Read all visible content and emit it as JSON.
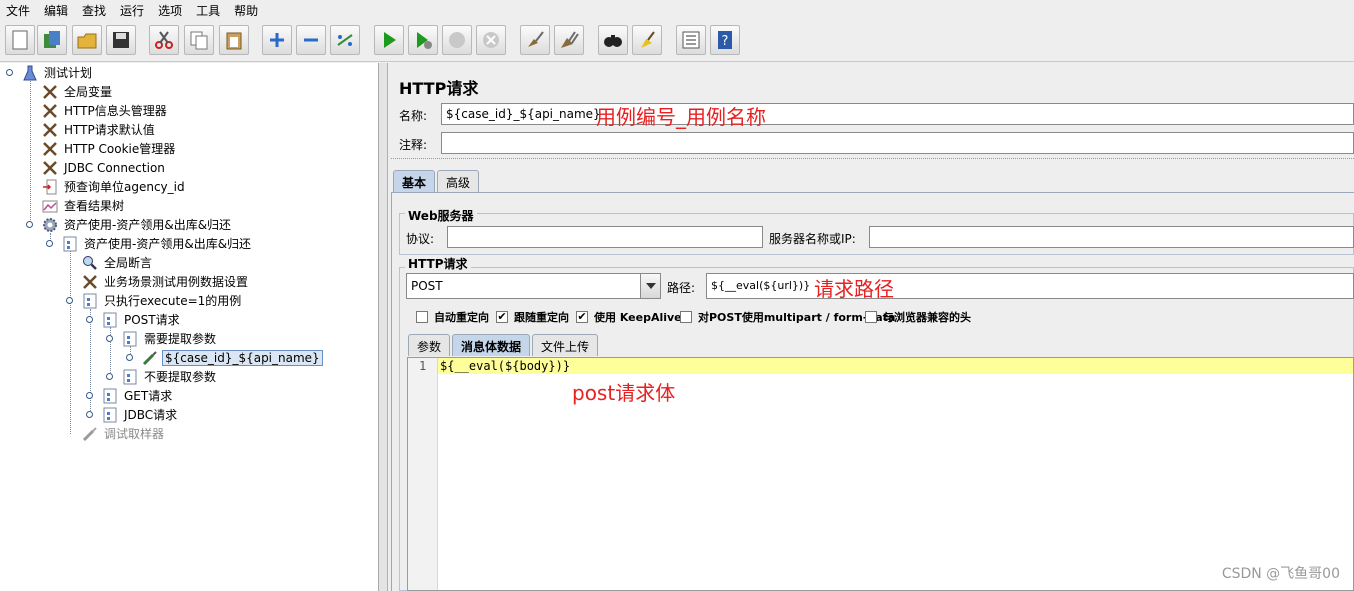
{
  "menu": [
    "文件",
    "编辑",
    "查找",
    "运行",
    "选项",
    "工具",
    "帮助"
  ],
  "toolbar": [
    "new-icon",
    "templates-icon",
    "open-icon",
    "save-icon",
    "cut-icon",
    "copy-icon",
    "paste-icon",
    "expand-icon",
    "collapse-icon",
    "toggle-icon",
    "start-icon",
    "start-no-pause-icon",
    "stop-icon",
    "shutdown-icon",
    "clear-icon",
    "clear-all-icon",
    "search-icon",
    "reset-search-icon",
    "function-helper-icon",
    "help-icon"
  ],
  "tree": {
    "plan": "测试计划",
    "global_vars": "全局变量",
    "header_manager": "HTTP信息头管理器",
    "http_defaults": "HTTP请求默认值",
    "cookie_manager": "HTTP Cookie管理器",
    "jdbc_connection": "JDBC Connection",
    "pre_query": "预查询单位agency_id",
    "results_tree": "查看结果树",
    "thread_group": "资产使用-资产领用&出库&归还",
    "controller": "资产使用-资产领用&出库&归还",
    "global_assert": "全局断言",
    "scenario_config": "业务场景测试用例数据设置",
    "if_controller": "只执行execute=1的用例",
    "post_request": "POST请求",
    "need_extract": "需要提取参数",
    "sampler_selected": "${case_id}_${api_name}",
    "no_extract": "不要提取参数",
    "get_request": "GET请求",
    "jdbc_request": "JDBC请求",
    "debug_sampler": "调试取样器"
  },
  "panel": {
    "title": "HTTP请求",
    "name_label": "名称:",
    "name_value": "${case_id}_${api_name}",
    "name_annotation": "用例编号_用例名称",
    "comment_label": "注释:",
    "comment_value": "",
    "tabs": [
      "基本",
      "高级"
    ],
    "web_server_title": "Web服务器",
    "protocol_label": "协议:",
    "protocol_value": "",
    "server_label": "服务器名称或IP:",
    "server_value": "",
    "http_request_title": "HTTP请求",
    "method_value": "POST",
    "path_label": "路径:",
    "path_value": "${__eval(${url})}",
    "path_annotation": "请求路径",
    "checkboxes": [
      {
        "label": "自动重定向",
        "checked": false
      },
      {
        "label": "跟随重定向",
        "checked": true
      },
      {
        "label": "使用 KeepAlive",
        "checked": true
      },
      {
        "label": "对POST使用multipart / form-data",
        "checked": false
      },
      {
        "label": "与浏览器兼容的头",
        "checked": false
      }
    ],
    "body_tabs": [
      "参数",
      "消息体数据",
      "文件上传"
    ],
    "line_number": "1",
    "body_code": "${__eval(${body})}",
    "body_annotation": "post请求体"
  },
  "watermark": "CSDN @飞鱼哥00"
}
